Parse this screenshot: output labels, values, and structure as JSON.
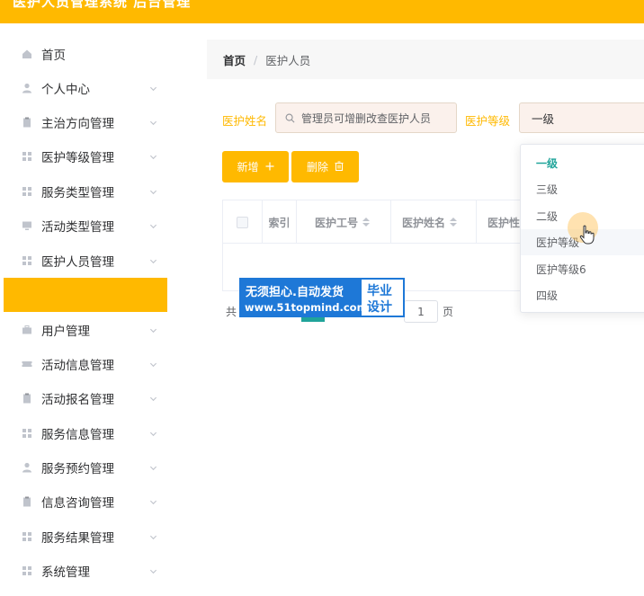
{
  "header": {
    "title": "医护人员管理系统 后台管理"
  },
  "sidebar": {
    "items": [
      {
        "label": "首页",
        "icon": "home-icon"
      },
      {
        "label": "个人中心",
        "icon": "user-icon"
      },
      {
        "label": "主治方向管理",
        "icon": "clipboard-icon"
      },
      {
        "label": "医护等级管理",
        "icon": "grid-icon"
      },
      {
        "label": "服务类型管理",
        "icon": "grid-icon"
      },
      {
        "label": "活动类型管理",
        "icon": "monitor-icon"
      },
      {
        "label": "医护人员管理",
        "icon": "grid-icon"
      },
      {
        "label": "",
        "icon": ""
      },
      {
        "label": "用户管理",
        "icon": "briefcase-icon"
      },
      {
        "label": "活动信息管理",
        "icon": "ticket-icon"
      },
      {
        "label": "活动报名管理",
        "icon": "clipboard-icon"
      },
      {
        "label": "服务信息管理",
        "icon": "grid-icon"
      },
      {
        "label": "服务预约管理",
        "icon": "user-icon"
      },
      {
        "label": "信息咨询管理",
        "icon": "clipboard-icon"
      },
      {
        "label": "服务结果管理",
        "icon": "grid-icon"
      },
      {
        "label": "系统管理",
        "icon": "grid-icon"
      }
    ]
  },
  "breadcrumb": {
    "home": "首页",
    "separator": "/",
    "current": "医护人员"
  },
  "search": {
    "name_label": "医护姓名",
    "name_value": "管理员可增删改查医护人员",
    "level_label": "医护等级",
    "level_value": "一级"
  },
  "toolbar": {
    "add_label": "新增",
    "delete_label": "删除"
  },
  "table": {
    "columns": [
      "索引",
      "医护工号",
      "医护姓名",
      "医护性"
    ]
  },
  "pagination": {
    "prefix": "共",
    "page": "1",
    "suffix": "页"
  },
  "dropdown": {
    "options": [
      "一级",
      "三级",
      "二级",
      "医护等级",
      "医护等级6",
      "四级"
    ],
    "selected": "一级",
    "hovered": "医护等级"
  },
  "watermark": {
    "line1": "无须担心.自动发货",
    "line2": "www.51topmind.com",
    "right1": "毕业",
    "right2": "设计"
  },
  "colors": {
    "accent": "#ffb900",
    "selected": "#20a49a",
    "watermark": "#1e78d7"
  }
}
